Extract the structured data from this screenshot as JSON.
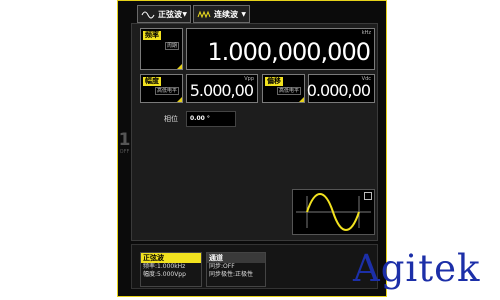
{
  "toolbar": {
    "waveform_button": {
      "label": "正弦波",
      "icon": "sine-icon"
    },
    "mode_button": {
      "label": "连续波",
      "icon": "continuous-wave-icon"
    }
  },
  "channel": {
    "number": "1",
    "state": "OFF"
  },
  "frequency": {
    "tag": "频率",
    "mini": "周期",
    "unit": "kHz",
    "value": "1.000,000,000"
  },
  "amplitude": {
    "tag": "幅度",
    "mini": "高低电平",
    "unit": "Vpp",
    "value": "5.000,00"
  },
  "offset": {
    "tag": "偏移",
    "mini": "高低电平",
    "unit": "Vdc",
    "value": "0.000,00"
  },
  "phase": {
    "label": "相位",
    "value": "0.00 °"
  },
  "preview": {
    "icon": "expand-icon",
    "wave_color": "#f2e21f"
  },
  "bottom_tabs": [
    {
      "title": "正弦波",
      "lines": [
        "频率:1.000kHz",
        "幅度:5.000Vpp"
      ]
    },
    {
      "title": "通道",
      "lines": [
        "同步:OFF",
        "同步极性:正极性"
      ]
    }
  ],
  "watermark": "Agitek",
  "colors": {
    "accent": "#f2e21f",
    "watermark": "#1c2fa8"
  }
}
